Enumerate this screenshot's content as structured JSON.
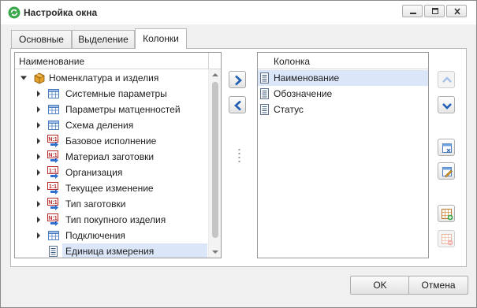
{
  "window": {
    "title": "Настройка окна",
    "icon": "refresh-green-icon"
  },
  "title_buttons": [
    "minimize-icon",
    "maximize-icon",
    "close-icon"
  ],
  "tabs": [
    {
      "label": "Основные",
      "active": false
    },
    {
      "label": "Выделение",
      "active": false
    },
    {
      "label": "Колонки",
      "active": true
    }
  ],
  "left_list": {
    "header": "Наименование",
    "root": {
      "label": "Номенклатура и изделия",
      "icon": "box-icon",
      "expanded": true
    },
    "items": [
      {
        "label": "Системные параметры",
        "icon": "table-icon",
        "expandable": true
      },
      {
        "label": "Параметры матценностей",
        "icon": "table-icon",
        "expandable": true
      },
      {
        "label": "Схема деления",
        "icon": "table-icon",
        "expandable": true
      },
      {
        "label": "Базовое исполнение",
        "icon": "n-to-1-link-icon",
        "expandable": true
      },
      {
        "label": "Материал заготовки",
        "icon": "n-to-1-link-icon",
        "expandable": true
      },
      {
        "label": "Организация",
        "icon": "one-to-one-link-icon",
        "expandable": true
      },
      {
        "label": "Текущее изменение",
        "icon": "one-to-one-link-icon",
        "expandable": true
      },
      {
        "label": "Тип заготовки",
        "icon": "n-to-1-link-icon",
        "expandable": true
      },
      {
        "label": "Тип покупного изделия",
        "icon": "n-to-1-link-icon",
        "expandable": true
      },
      {
        "label": "Подключения",
        "icon": "table-icon",
        "expandable": true
      },
      {
        "label": "Единица измерения",
        "icon": "field-icon",
        "expandable": false,
        "selected": true
      }
    ]
  },
  "right_list": {
    "header": "Колонка",
    "items": [
      {
        "label": "Наименование",
        "icon": "field-icon",
        "selected": true
      },
      {
        "label": "Обозначение",
        "icon": "field-icon",
        "selected": false
      },
      {
        "label": "Статус",
        "icon": "field-icon",
        "selected": false
      }
    ]
  },
  "move_buttons": [
    "add-column-arrow-icon",
    "remove-column-arrow-icon"
  ],
  "side_buttons": [
    {
      "icon": "move-up-icon",
      "enabled": false
    },
    {
      "icon": "move-down-icon",
      "enabled": true
    },
    {
      "icon": "column-settings-icon",
      "enabled": true
    },
    {
      "icon": "edit-column-icon",
      "enabled": true
    },
    {
      "icon": "add-group-icon",
      "enabled": true
    },
    {
      "icon": "remove-group-icon",
      "enabled": false
    }
  ],
  "footer": {
    "ok_label": "OK",
    "cancel_label": "Отмена"
  }
}
